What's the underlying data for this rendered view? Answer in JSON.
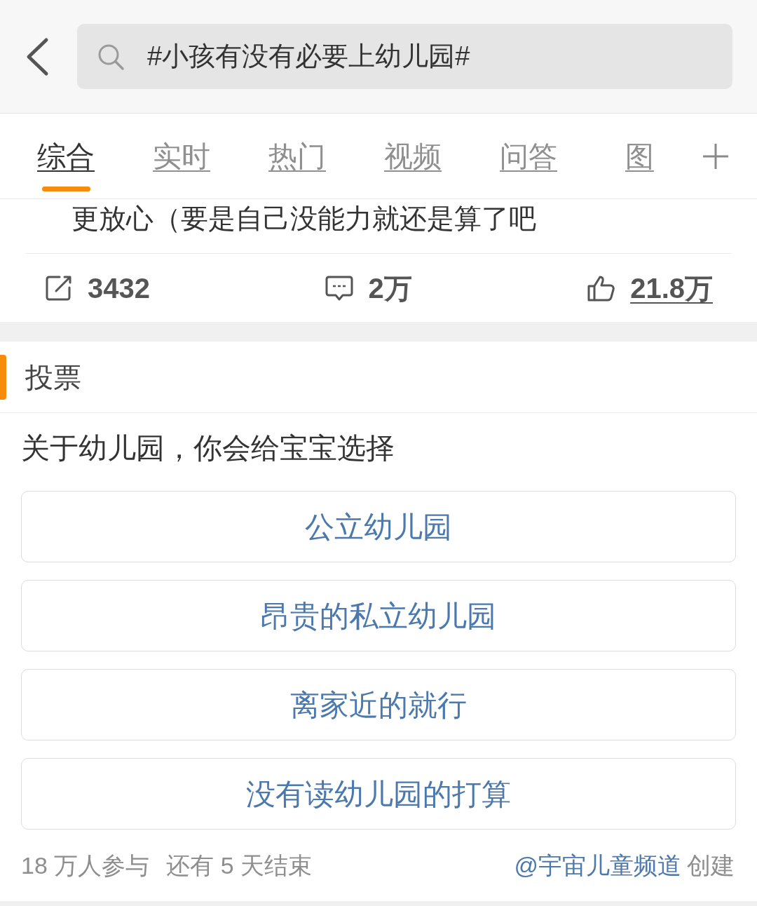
{
  "header": {
    "search": {
      "value": "#小孩有没有必要上幼儿园#"
    }
  },
  "tabs": [
    {
      "label": "综合",
      "selected": true
    },
    {
      "label": "实时",
      "selected": false
    },
    {
      "label": "热门",
      "selected": false
    },
    {
      "label": "视频",
      "selected": false
    },
    {
      "label": "问答",
      "selected": false
    },
    {
      "label": "图",
      "selected": false
    }
  ],
  "post": {
    "text": "更放心（要是自己没能力就还是算了吧",
    "actions": [
      {
        "kind": "share",
        "count": "3432",
        "underlined": false
      },
      {
        "kind": "comment",
        "count": "2万",
        "underlined": false
      },
      {
        "kind": "like",
        "count": "21.8万",
        "underlined": true
      }
    ]
  },
  "vote": {
    "title": "投票",
    "question": "关于幼儿园，你会给宝宝选择",
    "options": [
      {
        "label": "公立幼儿园"
      },
      {
        "label": "昂贵的私立幼儿园"
      },
      {
        "label": "离家近的就行"
      },
      {
        "label": "没有读幼儿园的打算"
      }
    ],
    "participants": "18 万人参与",
    "remaining": "还有 5 天结束",
    "creator": "@宇宙儿童频道",
    "created_label": "创建"
  }
}
